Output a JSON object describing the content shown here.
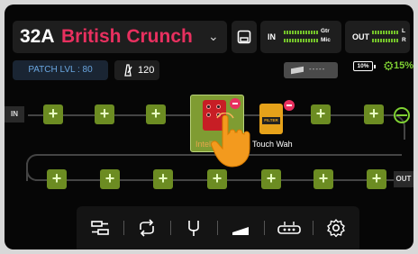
{
  "preset": {
    "number": "32A",
    "name": "British Crunch"
  },
  "input_meter": {
    "tag": "IN",
    "ch1": "Gtr",
    "ch2": "Mic"
  },
  "output_meter": {
    "tag": "OUT",
    "ch1": "L",
    "ch2": "R"
  },
  "patch_level": "PATCH LVL : 80",
  "tempo": "120",
  "expression": {
    "value": "-----"
  },
  "battery": "10%",
  "cpu_usage": "15%",
  "chain": {
    "in_label": "IN",
    "out_label": "OUT",
    "effects": [
      {
        "name": "Intelligent Harmony",
        "visible_label": "Intelli",
        "color": "#c71e25",
        "selected": true
      },
      {
        "name": "Touch Wah",
        "visible_label": "Touch Wah",
        "color": "#e6a21a",
        "panel": "FILTER",
        "selected": false
      }
    ]
  },
  "toolbar": {
    "icons": [
      "routing-icon",
      "looper-icon",
      "tuner-icon",
      "expression-pedal-icon",
      "footswitch-icon",
      "settings-icon"
    ]
  },
  "colors": {
    "accent_green": "#7fd133",
    "preset_red": "#e8305f",
    "slot_green": "#6c8c22"
  }
}
